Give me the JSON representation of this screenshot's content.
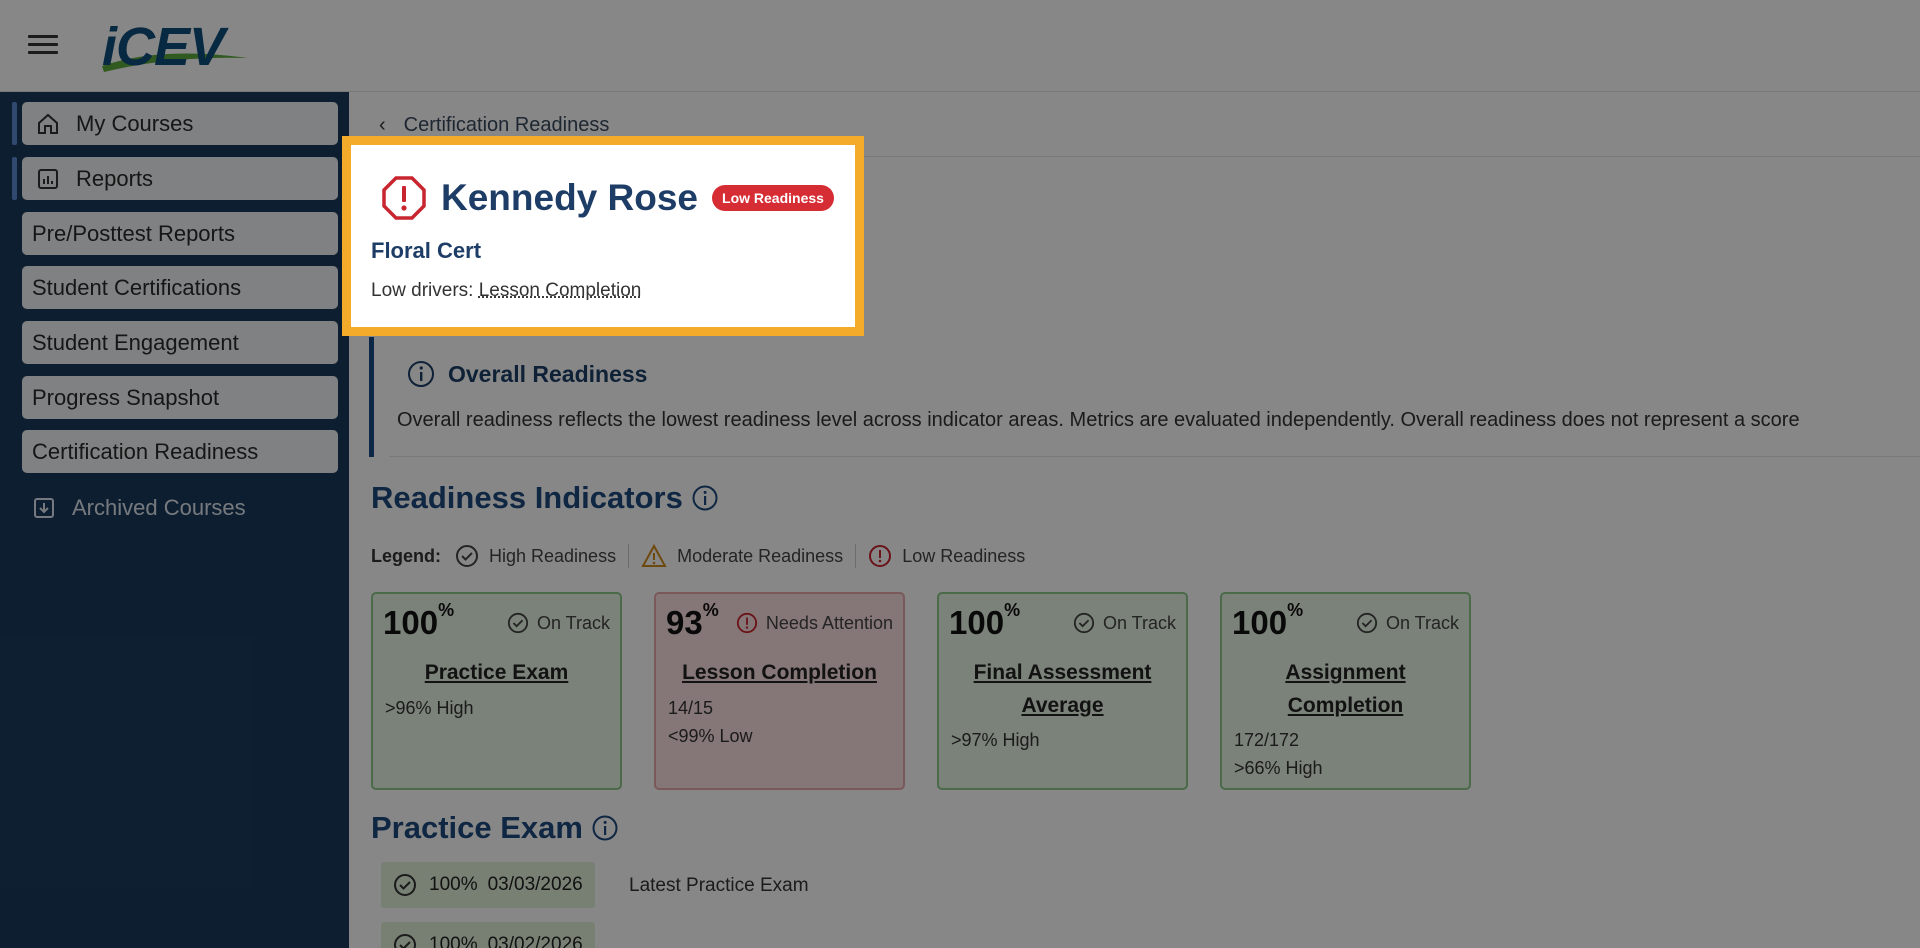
{
  "app": {
    "logo_text": "iCEV"
  },
  "sidebar": {
    "items": [
      {
        "label": "My Courses",
        "icon": "home-icon"
      },
      {
        "label": "Reports",
        "icon": "report-icon"
      },
      {
        "label": "Pre/Posttest Reports"
      },
      {
        "label": "Student Certifications"
      },
      {
        "label": "Student Engagement"
      },
      {
        "label": "Progress Snapshot"
      },
      {
        "label": "Certification Readiness"
      }
    ],
    "archived": {
      "label": "Archived Courses",
      "icon": "archive-icon"
    }
  },
  "breadcrumb": {
    "label": "Certification Readiness"
  },
  "student": {
    "name": "Kennedy Rose",
    "badge": "Low Readiness",
    "course": "Floral Cert",
    "drivers_prefix": "Low drivers: ",
    "drivers_link": "Lesson Completion"
  },
  "overall": {
    "title": "Overall Readiness",
    "description": "Overall readiness reflects the lowest readiness level across indicator areas. Metrics are evaluated independently. Overall readiness does not represent a score"
  },
  "indicators": {
    "title": "Readiness Indicators",
    "legend": {
      "label": "Legend:",
      "high": "High Readiness",
      "moderate": "Moderate Readiness",
      "low": "Low Readiness"
    },
    "cards": [
      {
        "value": "100",
        "unit": "%",
        "status": "On Track",
        "name": "Practice Exam",
        "meta1": ">96% High",
        "meta2": "",
        "level": "high"
      },
      {
        "value": "93",
        "unit": "%",
        "status": "Needs Attention",
        "name": "Lesson Completion",
        "meta1": "14/15",
        "meta2": "<99% Low",
        "level": "low"
      },
      {
        "value": "100",
        "unit": "%",
        "status": "On Track",
        "name_line1": "Final Assessment",
        "name_line2": "Average",
        "meta1": ">97% High",
        "meta2": "",
        "level": "high"
      },
      {
        "value": "100",
        "unit": "%",
        "status": "On Track",
        "name_line1": "Assignment",
        "name_line2": "Completion",
        "meta1": "172/172",
        "meta2": ">66% High",
        "level": "high"
      }
    ]
  },
  "practice_exam": {
    "title": "Practice Exam",
    "rows": [
      {
        "score": "100%",
        "date": "03/03/2026",
        "note": "Latest Practice Exam"
      },
      {
        "score": "100%",
        "date": "03/02/2026",
        "note": ""
      }
    ]
  },
  "colors": {
    "brand": "#1d3c66",
    "highlight": "#f5ab2a",
    "low": "#d62d35",
    "high_bg": "#e8f6e4",
    "low_bg": "#fcdfe0"
  }
}
